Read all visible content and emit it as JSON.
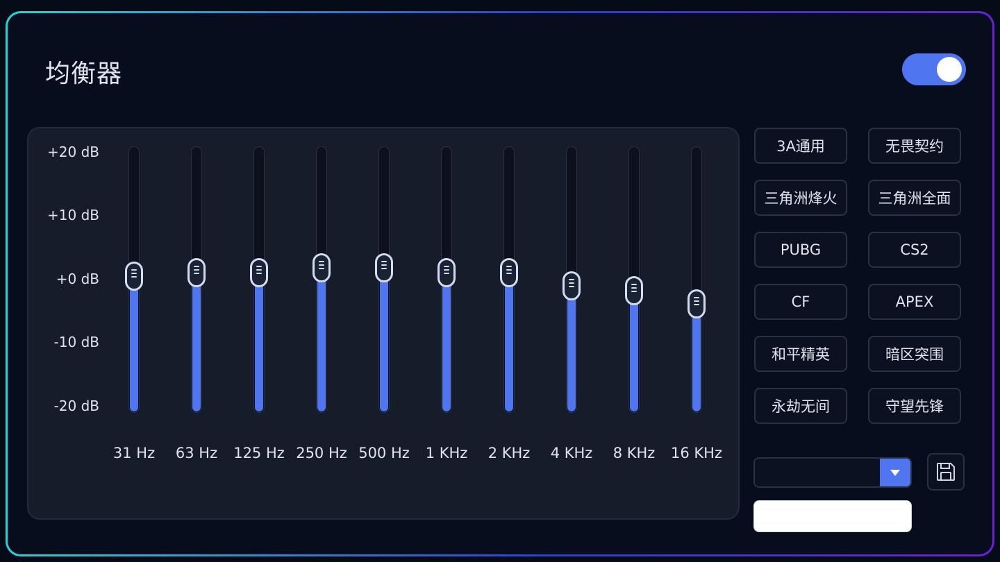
{
  "header": {
    "title": "均衡器",
    "power_toggle": {
      "on": true,
      "icon": "toggle-switch-icon"
    }
  },
  "equalizer": {
    "db_scale": [
      "+20 dB",
      "+10 dB",
      "+0 dB",
      "-10 dB",
      "-20 dB"
    ],
    "range_db": [
      -20,
      20
    ],
    "bands": [
      {
        "label": "31 Hz",
        "gain_db": 0.5
      },
      {
        "label": "63 Hz",
        "gain_db": 1.0
      },
      {
        "label": "125 Hz",
        "gain_db": 1.0
      },
      {
        "label": "250 Hz",
        "gain_db": 1.8
      },
      {
        "label": "500 Hz",
        "gain_db": 1.8
      },
      {
        "label": "1 KHz",
        "gain_db": 1.0
      },
      {
        "label": "2 KHz",
        "gain_db": 1.0
      },
      {
        "label": "4 KHz",
        "gain_db": -0.9
      },
      {
        "label": "8 KHz",
        "gain_db": -1.7
      },
      {
        "label": "16 KHz",
        "gain_db": -3.6
      }
    ]
  },
  "presets": [
    "3A通用",
    "无畏契约",
    "三角洲烽火",
    "三角洲全面",
    "PUBG",
    "CS2",
    "CF",
    "APEX",
    "和平精英",
    "暗区突围",
    "永劫无间",
    "守望先锋"
  ],
  "preset_select": {
    "value": "",
    "icon": "chevron-down-icon"
  },
  "save": {
    "icon": "save-disk-icon"
  },
  "name_input": {
    "value": "",
    "placeholder": ""
  },
  "colors": {
    "accent": "#5075f0",
    "background": "#070d1c",
    "panel": "#161c29",
    "border_gradient": [
      "#22d3d6",
      "#2a3fd8",
      "#6b1fd6"
    ]
  }
}
